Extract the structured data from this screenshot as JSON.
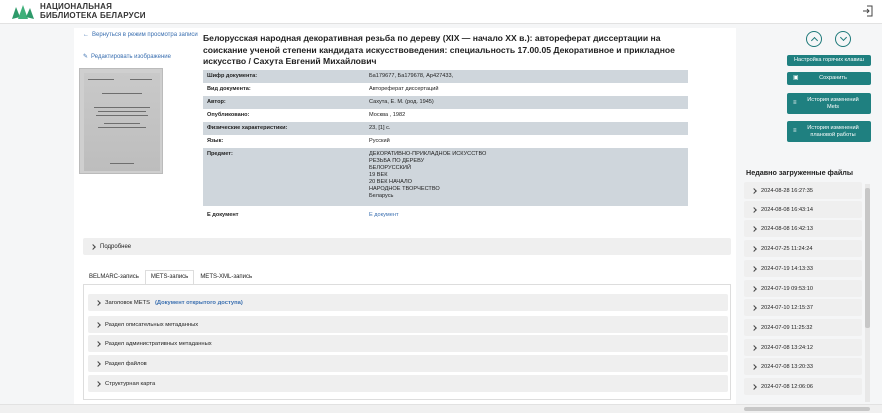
{
  "header": {
    "logo_text_line1": "НАЦИОНАЛЬНАЯ",
    "logo_text_line2": "БИБЛИОТЕКА БЕЛАРУСИ",
    "logout_icon": "logout-icon"
  },
  "left": {
    "back_link": "Вернуться в режим просмотра записи",
    "edit_link": "Редактировать изображение"
  },
  "document": {
    "title": "Белорусская народная декоративная резьба по дереву (XIX — начало XX в.): автореферат диссертации на соискание ученой степени кандидата искусствоведения: специальность 17.00.05 Декоративное и прикладное искусство / Сахута Евгений Михайлович",
    "fields": [
      {
        "label": "Шифр документа:",
        "value": "Ба179677, Ба179678, Ар427433,",
        "shaded": true
      },
      {
        "label": "Вид документа:",
        "value": "Автореферат диссертаций",
        "shaded": false
      },
      {
        "label": "Автор:",
        "value": "Сахута, Е. М. (род. 1945)",
        "shaded": true
      },
      {
        "label": "Опубликовано:",
        "value": "Москва , 1982",
        "shaded": false
      },
      {
        "label": "Физические характеристики:",
        "value": "23, [1] с.",
        "shaded": true
      },
      {
        "label": "Язык:",
        "value": "Русский",
        "shaded": false
      }
    ],
    "subject_label": "Предмет:",
    "subject_lines": [
      "ДЕКОРАТИВНО-ПРИКЛАДНОЕ ИСКУССТВО",
      "РЕЗЬБА ПО ДЕРЕВУ",
      "БЕЛОРУССКИЙ",
      "19 ВЕК",
      "20 ВЕК НАЧАЛО",
      "НАРОДНОЕ ТВОРЧЕСТВО",
      "Беларусь"
    ],
    "edoc_label": "Е документ",
    "edoc_value": "Е документ"
  },
  "accordion_more": "Подробнее",
  "tabs": [
    {
      "label": "BELMARC-запись",
      "active": false
    },
    {
      "label": "METS-запись",
      "active": true
    },
    {
      "label": "METS-XML-запись",
      "active": false
    }
  ],
  "mets_sections": {
    "header_label": "Заголовок METS",
    "open_access": "(Документ открытого доступа)",
    "descriptive": "Раздел описательных метаданных",
    "administrative": "Раздел административных метаданных",
    "files": "Раздел файлов",
    "structmap": "Структурная карта"
  },
  "right": {
    "hotkeys_button": "Настройка горячих клавиш",
    "save_button": "Сохранить",
    "mets_history_button": "История изменений Mets",
    "plan_history_button": "История изменений плановой работы",
    "recent_title": "Недавно загруженные файлы",
    "recent_files": [
      "2024-08-28 16:27:35",
      "2024-08-08 16:43:14",
      "2024-08-08 16:42:13",
      "2024-07-25 11:24:24",
      "2024-07-19 14:13:33",
      "2024-07-19 09:53:10",
      "2024-07-10 12:15:37",
      "2024-07-09 11:25:32",
      "2024-07-08 13:24:12",
      "2024-07-08 13:20:33",
      "2024-07-08 12:06:06"
    ]
  },
  "colors": {
    "accent": "#1f8080",
    "link": "#3a6fb0",
    "row_shade": "#cfd6dc"
  }
}
